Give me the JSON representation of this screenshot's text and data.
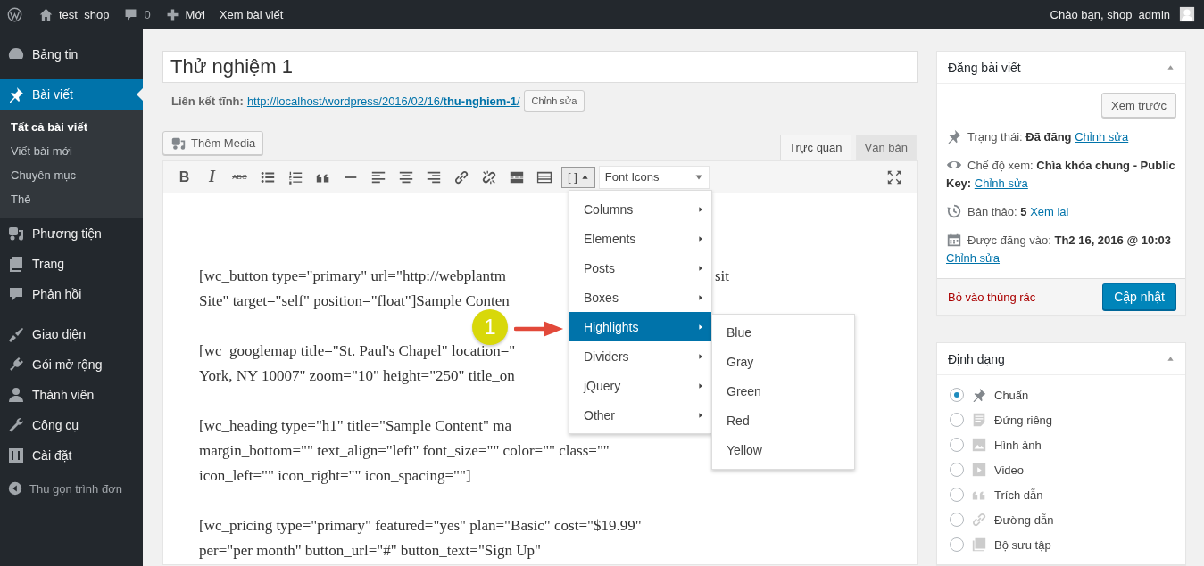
{
  "admin_bar": {
    "site": "test_shop",
    "comments": "0",
    "new": "Mới",
    "view": "Xem bài viết",
    "greeting": "Chào bạn, shop_admin"
  },
  "sidebar": {
    "groups": [
      [
        {
          "label": "Bảng tin",
          "selected": false
        }
      ],
      [
        {
          "label": "Bài viết",
          "selected": true,
          "children": [
            {
              "label": "Tất cả bài viết",
              "selected": true
            },
            {
              "label": "Viết bài mới",
              "selected": false
            },
            {
              "label": "Chuyên mục",
              "selected": false
            },
            {
              "label": "Thẻ",
              "selected": false
            }
          ]
        },
        {
          "label": "Phương tiện",
          "selected": false
        },
        {
          "label": "Trang",
          "selected": false
        },
        {
          "label": "Phản hồi",
          "selected": false
        }
      ],
      [
        {
          "label": "Giao diện",
          "selected": false
        },
        {
          "label": "Gói mở rộng",
          "selected": false
        },
        {
          "label": "Thành viên",
          "selected": false
        },
        {
          "label": "Công cụ",
          "selected": false
        },
        {
          "label": "Cài đặt",
          "selected": false
        }
      ]
    ],
    "collapse": "Thu gọn trình đơn"
  },
  "post": {
    "title": "Thử nghiệm 1",
    "permalink_label": "Liên kết tĩnh:",
    "permalink": "http://localhost/wordpress/2016/02/16/**thu-nghiem-1**/",
    "permalink_button": "Chỉnh sửa",
    "add_media": "Thêm Media"
  },
  "editor": {
    "tabs": [
      {
        "label": "Trực quan",
        "selected": true
      },
      {
        "label": "Văn bản",
        "selected": false
      }
    ],
    "toolbar": [
      {
        "kind": "bold",
        "label": "B"
      },
      {
        "kind": "italic",
        "label": "I"
      },
      {
        "kind": "strike",
        "label": "ABC"
      },
      {
        "kind": "bullet-list"
      },
      {
        "kind": "number-list"
      },
      {
        "kind": "quote"
      },
      {
        "kind": "hr"
      },
      {
        "kind": "align-left"
      },
      {
        "kind": "align-center"
      },
      {
        "kind": "align-right"
      },
      {
        "kind": "link"
      },
      {
        "kind": "unlink"
      },
      {
        "kind": "more"
      },
      {
        "kind": "toolbar-toggle"
      }
    ],
    "shortcode_button": {
      "label": "[ ]",
      "expanded": true
    },
    "font_select": "Font Icons",
    "paragraphs": [
      [
        {
          "left": "[wc_button type=\"primary\" url=\"http://webplantm",
          "right": "sit"
        },
        {
          "left": "Site\" target=\"self\" position=\"float\"]Sample Conten"
        }
      ],
      [
        {
          "left": "[wc_googlemap title=\"St. Paul's Chapel\" location=\""
        },
        {
          "left": "York, NY 10007\" zoom=\"10\" height=\"250\" title_on"
        }
      ],
      [
        {
          "left": "[wc_heading type=\"h1\" title=\"Sample Content\" ma"
        },
        {
          "left": "margin_bottom=\"\" text_align=\"left\" font_size=\"\" color=\"\" class=\"\""
        },
        {
          "left": "icon_left=\"\" icon_right=\"\" icon_spacing=\"\"]"
        }
      ],
      [
        {
          "left": "[wc_pricing type=\"primary\" featured=\"yes\" plan=\"Basic\" cost=\"$19.99\""
        },
        {
          "left": "per=\"per month\" button_url=\"#\" button_text=\"Sign Up\""
        }
      ]
    ],
    "menu": [
      {
        "label": "Columns",
        "selected": false
      },
      {
        "label": "Elements",
        "selected": false
      },
      {
        "label": "Posts",
        "selected": false
      },
      {
        "label": "Boxes",
        "selected": false
      },
      {
        "label": "Highlights",
        "selected": true
      },
      {
        "label": "Dividers",
        "selected": false
      },
      {
        "label": "jQuery",
        "selected": false
      },
      {
        "label": "Other",
        "selected": false
      }
    ],
    "submenu": [
      "Blue",
      "Gray",
      "Green",
      "Red",
      "Yellow"
    ],
    "callout": "1"
  },
  "publish": {
    "title": "Đăng bài viết",
    "preview": "Xem trước",
    "rows": [
      {
        "label": "Trạng thái:",
        "value": "Đã đăng",
        "link": "Chỉnh sửa"
      },
      {
        "label": "Chế độ xem:",
        "value": "Chìa khóa chung - Public Key:",
        "link": "Chỉnh sửa"
      },
      {
        "label": "Bản thảo:",
        "value": "5",
        "link": "Xem lai"
      },
      {
        "label": "Được đăng vào:",
        "value": "Th2 16, 2016 @ 10:03",
        "link": "Chỉnh sửa"
      }
    ],
    "trash": "Bỏ vào thùng rác",
    "update": "Cập nhật"
  },
  "format": {
    "title": "Định dạng",
    "options": [
      {
        "label": "Chuẩn",
        "selected": true
      },
      {
        "label": "Đứng riêng",
        "selected": false
      },
      {
        "label": "Hình ảnh",
        "selected": false
      },
      {
        "label": "Video",
        "selected": false
      },
      {
        "label": "Trích dẫn",
        "selected": false
      },
      {
        "label": "Đường dẫn",
        "selected": false
      },
      {
        "label": "Bộ sưu tập",
        "selected": false
      }
    ]
  }
}
